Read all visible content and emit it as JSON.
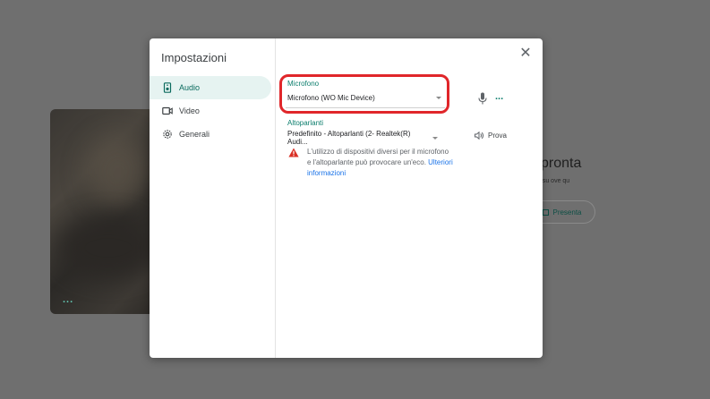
{
  "background": {
    "title": "pronta",
    "subtitle": "p su ove qu",
    "present_label": "Presenta",
    "video_more": "..."
  },
  "dialog": {
    "title": "Impostazioni",
    "close_icon": "close-icon"
  },
  "nav": [
    {
      "label": "Audio",
      "icon": "speaker-device-icon",
      "active": true
    },
    {
      "label": "Video",
      "icon": "video-camera-icon",
      "active": false
    },
    {
      "label": "Generali",
      "icon": "gear-icon",
      "active": false
    }
  ],
  "audio": {
    "mic_label": "Microfono",
    "mic_value": "Microfono (WO Mic Device)",
    "speaker_label": "Altoparlanti",
    "speaker_value": "Predefinito - Altoparlanti (2- Realtek(R) Audi...",
    "test_label": "Prova",
    "more": "...",
    "warning_text": "L'utilizzo di dispositivi diversi per il microfono e l'altoparlante può provocare un'eco.",
    "warning_link": "Ulteriori informazioni"
  },
  "colors": {
    "accent": "#0b7d6c",
    "active_bg": "#e6f3f1",
    "highlight": "#e0262a",
    "link": "#1a73e8",
    "warning": "#d93025"
  }
}
